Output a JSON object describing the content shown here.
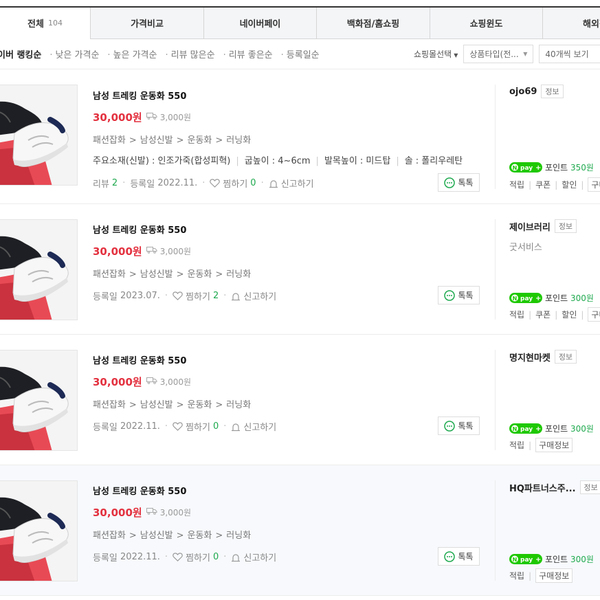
{
  "tabs": [
    {
      "label": "전체",
      "count": "104",
      "active": true
    },
    {
      "label": "가격비교"
    },
    {
      "label": "네이버페이"
    },
    {
      "label": "백화점/홈쇼핑"
    },
    {
      "label": "쇼핑윈도"
    },
    {
      "label": "해외직"
    }
  ],
  "sort": {
    "items": [
      "네이버 랭킹순",
      "낮은 가격순",
      "높은 가격순",
      "리뷰 많은순",
      "리뷰 좋은순",
      "등록일순"
    ],
    "visible_first": "이버 랭킹순"
  },
  "filters": {
    "mall_select": "쇼핑몰선택",
    "product_type": "상품타입(전...",
    "page_size": "40개씩 보기"
  },
  "labels": {
    "review": "리뷰",
    "registered": "등록일",
    "wish": "찜하기",
    "report": "신고하기",
    "talk": "톡톡",
    "info": "정보",
    "point": "포인트",
    "accrue": "적립",
    "coupon": "쿠폰",
    "discount": "할인",
    "purchase_info": "구매정보",
    "purchase_trunc": "구매",
    "npay_logo": "pay"
  },
  "products": [
    {
      "title": "남성 트레킹 운동화 550",
      "price": "30,000원",
      "shipping": "3,000원",
      "category": [
        "패션잡화",
        "남성신발",
        "운동화",
        "러닝화"
      ],
      "specs": [
        "주요소재(신발) : 인조가죽(합성피혁)",
        "굽높이 : 4~6cm",
        "발목높이 : 미드탑",
        "솔 : 폴리우레탄"
      ],
      "review_count": "2",
      "reg_date": "2022.11.",
      "wish_count": "0",
      "seller": "ojo69",
      "seller_sub": "",
      "points": "350원"
    },
    {
      "title": "남성 트레킹 운동화 550",
      "price": "30,000원",
      "shipping": "3,000원",
      "category": [
        "패션잡화",
        "남성신발",
        "운동화",
        "러닝화"
      ],
      "reg_date": "2023.07.",
      "wish_count": "2",
      "seller": "제이브러리",
      "seller_sub": "굿서비스",
      "points": "300원"
    },
    {
      "title": "남성 트레킹 운동화 550",
      "price": "30,000원",
      "shipping": "3,000원",
      "category": [
        "패션잡화",
        "남성신발",
        "운동화",
        "러닝화"
      ],
      "reg_date": "2022.11.",
      "wish_count": "0",
      "seller": "명지현마켓",
      "seller_sub": "",
      "points": "300원"
    },
    {
      "title": "남성 트레킹 운동화 550",
      "price": "30,000원",
      "shipping": "3,000원",
      "category": [
        "패션잡화",
        "남성신발",
        "운동화",
        "러닝화"
      ],
      "reg_date": "2022.11.",
      "wish_count": "0",
      "seller": "HQ파트너스주...",
      "seller_sub": "",
      "points": "300원"
    }
  ]
}
